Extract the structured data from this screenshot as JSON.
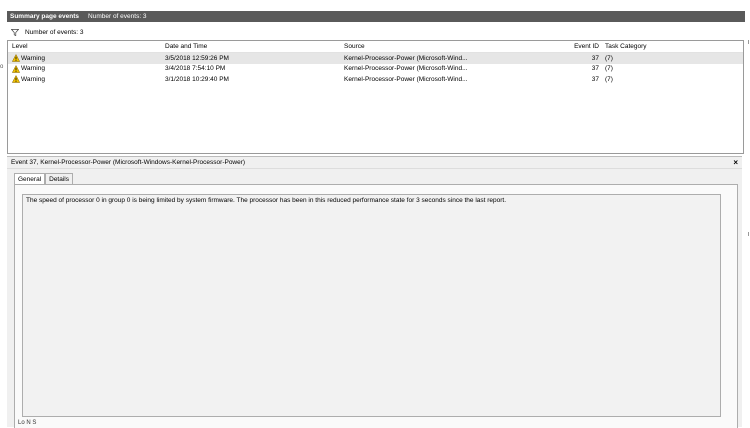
{
  "header": {
    "title": "Summary page events",
    "subtitle": "Number of events: 3"
  },
  "filter": {
    "icon": "funnel-icon",
    "label": "Number of events: 3"
  },
  "table": {
    "columns": {
      "level": "Level",
      "date": "Date and Time",
      "source": "Source",
      "event_id": "Event ID",
      "task": "Task Category"
    },
    "rows": [
      {
        "level": "Warning",
        "date": "3/5/2018 12:59:26 PM",
        "source": "Kernel-Processor-Power (Microsoft-Wind...",
        "event_id": "37",
        "task": "(7)"
      },
      {
        "level": "Warning",
        "date": "3/4/2018 7:54:10 PM",
        "source": "Kernel-Processor-Power (Microsoft-Wind...",
        "event_id": "37",
        "task": "(7)"
      },
      {
        "level": "Warning",
        "date": "3/1/2018 10:29:40 PM",
        "source": "Kernel-Processor-Power (Microsoft-Wind...",
        "event_id": "37",
        "task": "(7)"
      }
    ]
  },
  "detail": {
    "title": "Event 37, Kernel-Processor-Power (Microsoft-Windows-Kernel-Processor-Power)",
    "close": "×",
    "tabs": {
      "general": "General",
      "details": "Details"
    },
    "message": "The speed of processor 0 in group 0 is being limited by system firmware. The processor has been in this reduced performance state for 3 seconds since the last report.",
    "bottom": "Lo  N          S"
  },
  "edge": {
    "left_mark": "o"
  },
  "colors": {
    "titlebar": "#5a5a5a",
    "warning": "#f2c200",
    "panel": "#f0f0f0"
  }
}
